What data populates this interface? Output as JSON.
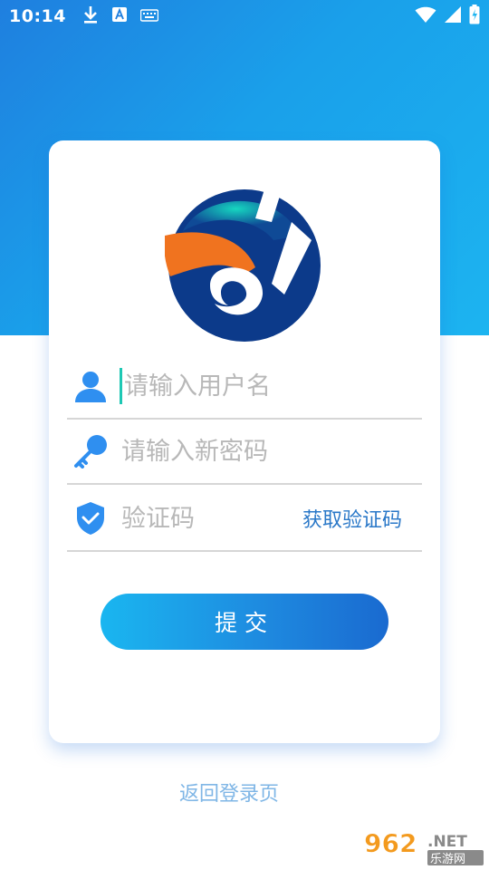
{
  "status_bar": {
    "time": "10:14",
    "icons_left": [
      "download-icon",
      "text-a-icon",
      "keyboard-icon"
    ],
    "icons_right": [
      "wifi-icon",
      "signal-icon",
      "battery-charging-icon"
    ]
  },
  "form": {
    "username_placeholder": "请输入用户名",
    "password_placeholder": "请输入新密码",
    "code_placeholder": "验证码",
    "get_code_label": "获取验证码",
    "submit_label": "提交"
  },
  "footer": {
    "back_link": "返回登录页"
  },
  "watermark": {
    "number": "962",
    "suffix": ".NET",
    "site": "乐游网"
  },
  "colors": {
    "hero_start": "#1f7fdf",
    "hero_end": "#1cb4f0",
    "accent_blue": "#2a78c8",
    "icon_blue": "#2f8ff0",
    "logo_navy": "#0c3a8a",
    "logo_orange": "#f0731f",
    "logo_teal": "#12b7a7"
  }
}
